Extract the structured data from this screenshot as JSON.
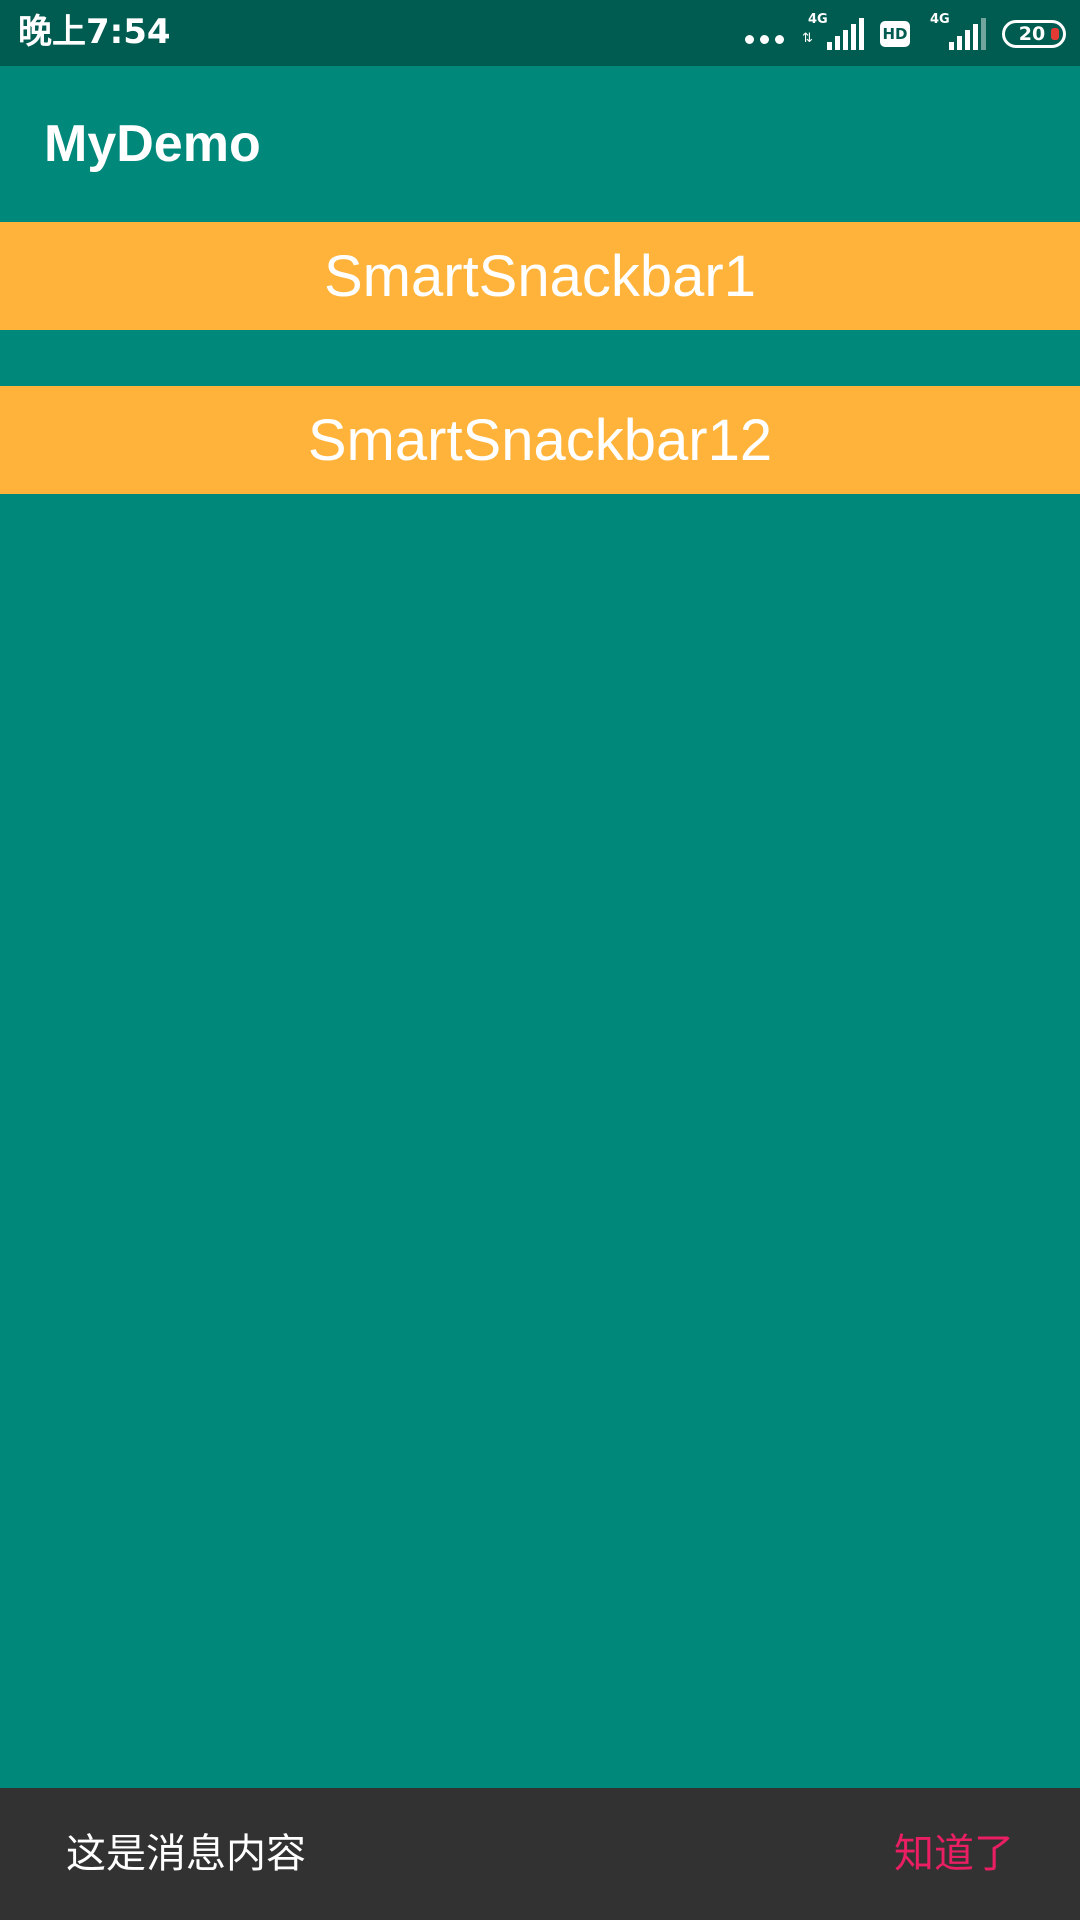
{
  "status_bar": {
    "time": "晚上7:54",
    "network_label_1": "4G",
    "network_arrows": "⇅",
    "hd_label": "HD",
    "network_label_2": "4G",
    "battery_level": "20"
  },
  "app_bar": {
    "title": "MyDemo"
  },
  "buttons": [
    {
      "label": "SmartSnackbar1"
    },
    {
      "label": "SmartSnackbar12"
    }
  ],
  "snackbar": {
    "message": "这是消息内容",
    "action_label": "知道了"
  },
  "colors": {
    "status_bar_bg": "#005C50",
    "primary": "#00897B",
    "button_bg": "#FFB33A",
    "snackbar_bg": "#323232",
    "snackbar_action": "#E91E63",
    "battery_low": "#E53935"
  }
}
